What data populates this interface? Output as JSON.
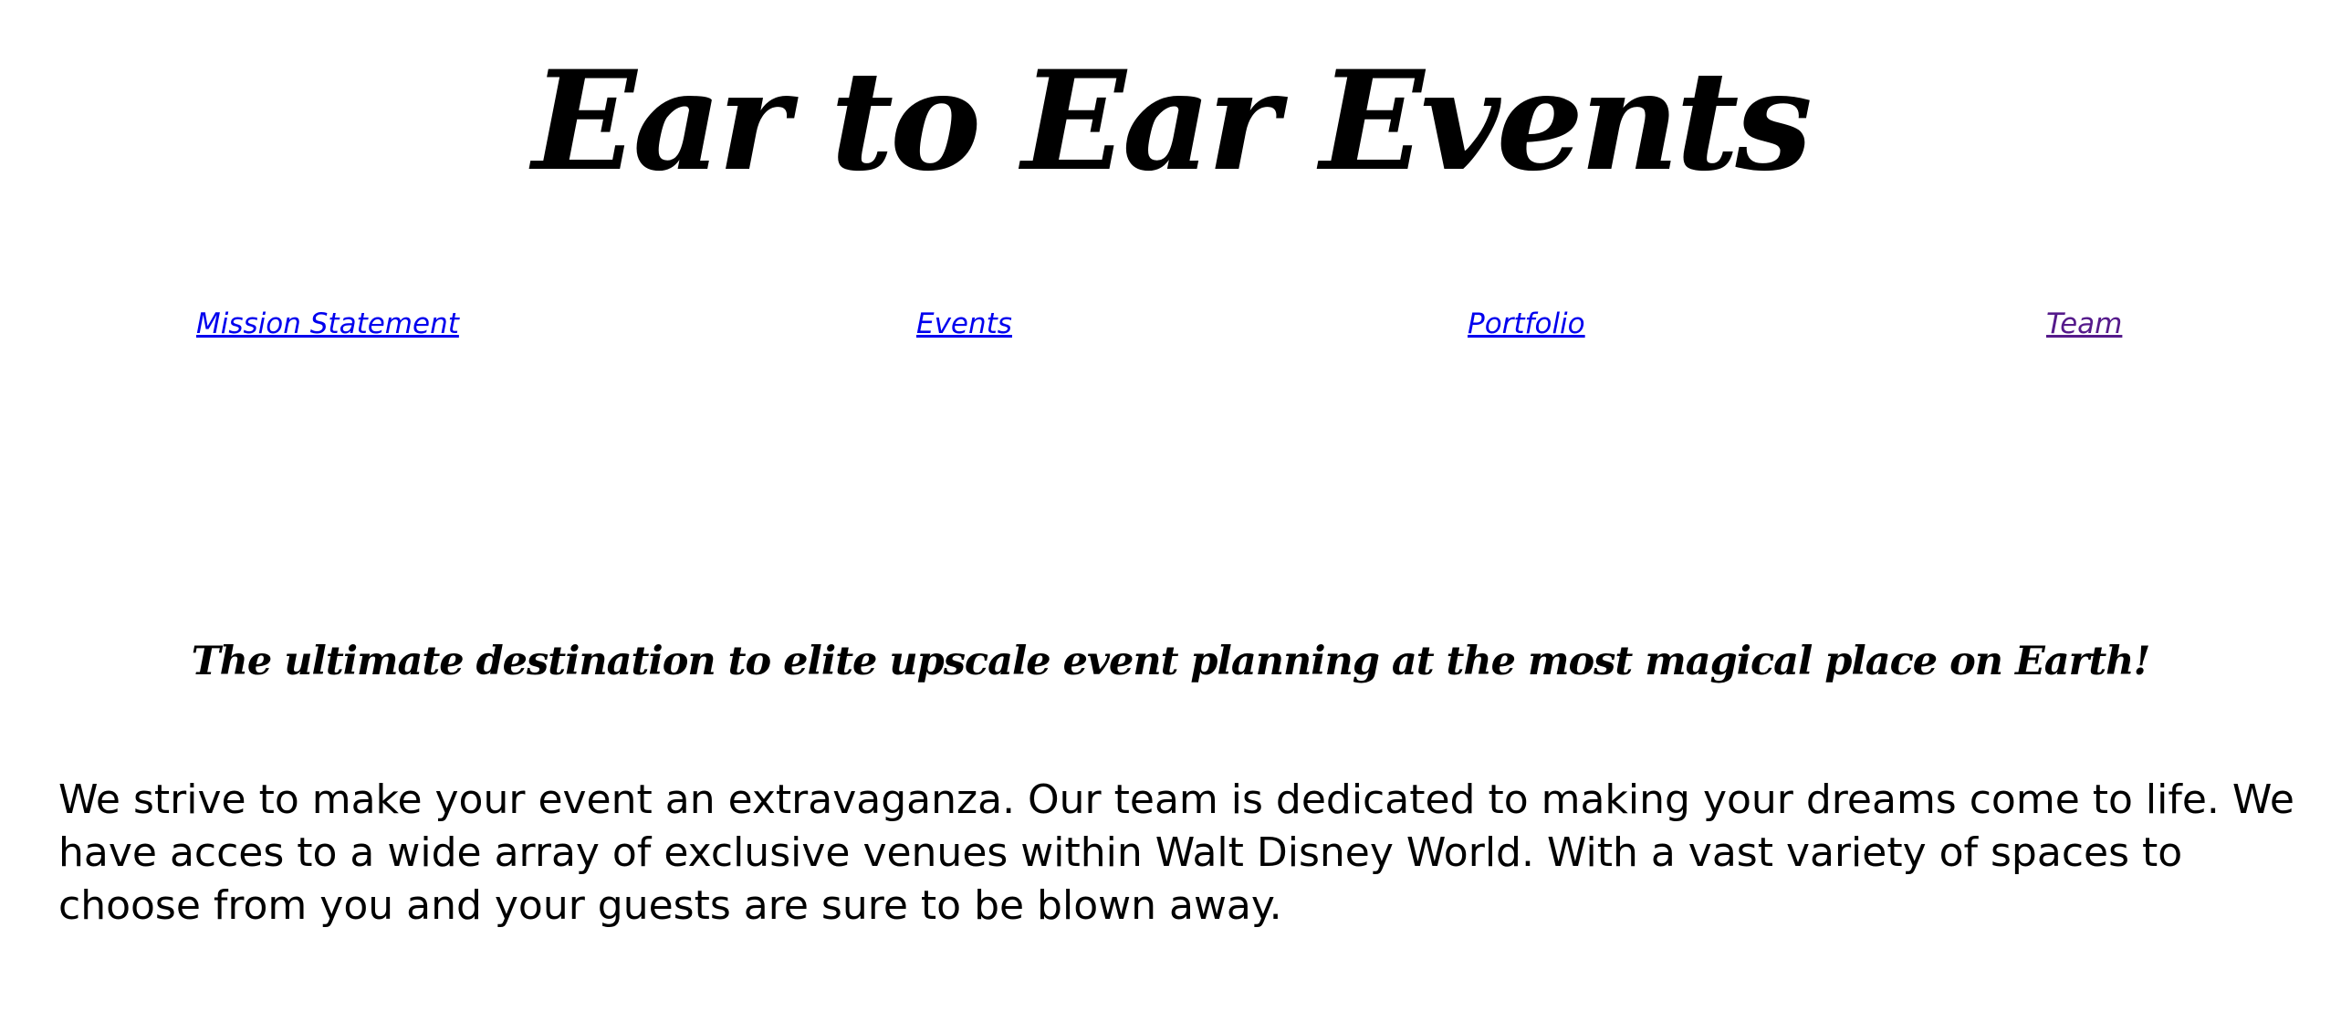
{
  "header": {
    "title": "Ear to Ear Events"
  },
  "nav": {
    "items": [
      {
        "label": "Mission Statement"
      },
      {
        "label": "Events"
      },
      {
        "label": "Portfolio"
      },
      {
        "label": "Team"
      }
    ]
  },
  "main": {
    "tagline": "The ultimate destination to elite upscale event planning at the most magical place on Earth!",
    "intro": "We strive to make your event an extravaganza. Our team is dedicated to making your dreams come to life. We have acces to a wide array of exclusive venues within Walt Disney World. With a vast variety of spaces to choose from you and your guests are sure to be blown away."
  },
  "colors": {
    "link": "#0000ee",
    "visited_link": "#551a8b",
    "text": "#000000",
    "background": "#ffffff"
  }
}
